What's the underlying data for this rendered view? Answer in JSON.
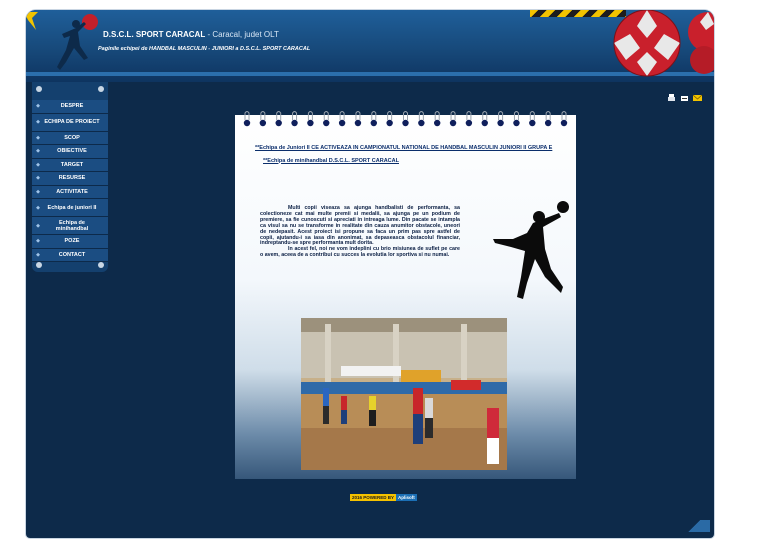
{
  "header": {
    "title": "D.S.C.L. SPORT CARACAL",
    "title_suffix": " - Caracal, judet OLT",
    "tagline": "Paginile echipei de HANDBAL MASCULIN - JUNIORI a D.S.C.L. SPORT CARACAL"
  },
  "top_icons": [
    "print-icon",
    "printer-icon",
    "email-icon"
  ],
  "sidebar": {
    "items": [
      {
        "label": "DESPRE"
      },
      {
        "label": "ECHIPA DE PROIECT"
      },
      {
        "label": "SCOP"
      },
      {
        "label": "OBIECTIVE"
      },
      {
        "label": "TARGET"
      },
      {
        "label": "RESURSE"
      },
      {
        "label": "ACTIVITATE"
      },
      {
        "label": "Echipa de juniori II"
      },
      {
        "label": "Echipa de minihandbal"
      },
      {
        "label": "POZE"
      },
      {
        "label": "CONTACT"
      }
    ]
  },
  "content": {
    "links": [
      "**Echipa de Juniori II CE ACTIVEAZA IN CAMPIONATUL NATIONAL DE HANDBAL MASCULIN JUNIORI II GRUPA E",
      "**Echipa de minihandbal D.S.C.L. SPORT CARACAL"
    ],
    "paragraph_1": "Multi copii viseaza sa ajunga handbalisti de performanta, sa colectioneze cat mai multe premii si medalii, sa ajunga pe un podium de premiere, sa fie cunoscuti si apreciati in intreaga lume. Din pacate se intampla ca visul sa nu se transforme in realitate din cauza anumitor obstacole, uneori de nedepasit. Acest proiect isi propune sa faca un prim pas spre astfel de copii, ajutandu-i sa iasa din anonimat, sa depaseasca obstacolul financiar, indreptandu-se spre performanta mult dorita.",
    "paragraph_2": "In acest fel, noi ne vom indeplini cu brio misiunea de suflet pe care o avem, aceea de a contribui cu succes la evolutia lor sportiva si nu numai."
  },
  "footer": {
    "powered_label": "2016 POWERED BY",
    "brand": "Aplisoft"
  },
  "colors": {
    "page_bg": "#ffffff",
    "frame_bg": "#0d2a4a",
    "header_bg": "#1f5f9a",
    "menu_bg": "#1b4d82",
    "link_color": "#0b2e6b",
    "accent_yellow": "#f5c200"
  }
}
